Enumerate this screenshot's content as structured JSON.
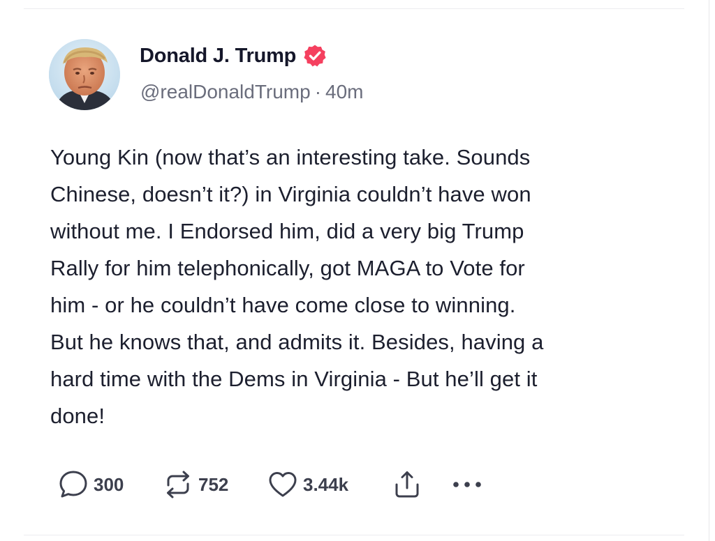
{
  "post": {
    "author": {
      "display_name": "Donald J. Trump",
      "handle": "@realDonaldTrump",
      "verified": true
    },
    "separator": "·",
    "time": "40m",
    "body_lines": [
      "Young Kin (now that’s an interesting take. Sounds",
      "Chinese, doesn’t it?) in Virginia couldn’t have won",
      "without me. I Endorsed him, did a very big Trump",
      "Rally for him telephonically, got MAGA to Vote for",
      "him - or he couldn’t have come close to winning.",
      "But he knows that, and admits it. Besides, having a",
      "hard time with the Dems in Virginia - But he’ll get it",
      "done!"
    ],
    "stats": {
      "replies": "300",
      "reposts": "752",
      "likes": "3.44k"
    }
  },
  "icons": {
    "reply": "speech-bubble-icon",
    "repost": "repost-arrows-icon",
    "like": "heart-icon",
    "share": "share-upload-icon",
    "more": "more-dots-icon",
    "verified": "verified-badge-icon"
  },
  "colors": {
    "verified_badge": "#f5405f",
    "text": "#1c1f2e",
    "muted": "#6a6d7c"
  }
}
